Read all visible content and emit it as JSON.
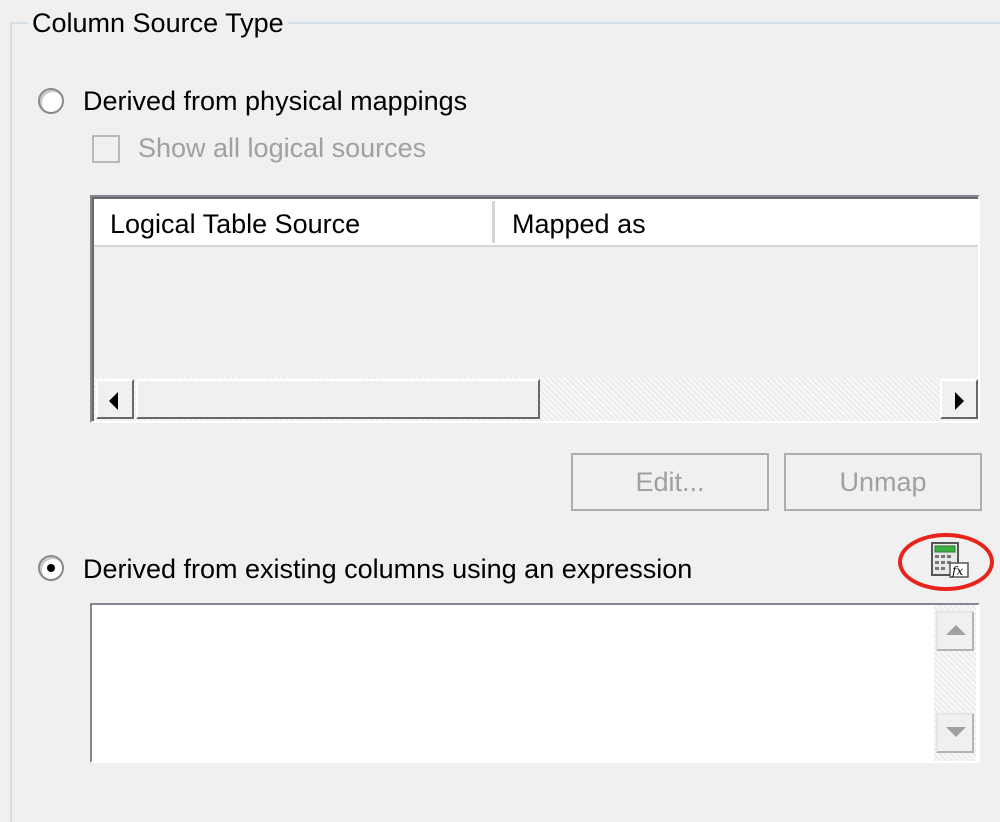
{
  "group": {
    "title": "Column Source Type"
  },
  "physical": {
    "radio_label": "Derived from physical mappings",
    "selected": false,
    "show_all_label": "Show all logical sources",
    "show_all_checked": false,
    "show_all_enabled": false,
    "table": {
      "columns": [
        "Logical Table Source",
        "Mapped as"
      ],
      "rows": []
    },
    "edit_button": "Edit...",
    "unmap_button": "Unmap"
  },
  "expression": {
    "radio_label": "Derived from existing columns using an expression",
    "selected": true,
    "value": "",
    "builder_icon": "expression-builder-icon"
  },
  "colors": {
    "highlight_ring": "#e8231b",
    "disabled_text": "#a0a0a0",
    "window_bg": "#f0f0f0"
  }
}
